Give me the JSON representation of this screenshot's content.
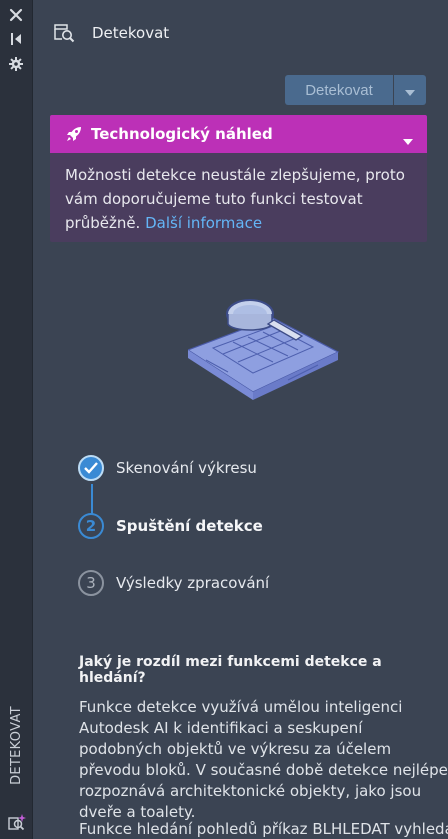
{
  "strip": {
    "close_icon": "close-icon",
    "collapse_icon": "collapse-panel-icon",
    "settings_icon": "gear-icon",
    "vertical_label": "DETEKOVAT",
    "bottom_icon": "detect-magnifier-sparkle-icon"
  },
  "header": {
    "title": "Detekovat",
    "icon": "detect-magnifier-icon"
  },
  "toolbar": {
    "detect_label": "Detekovat",
    "dropdown_icon": "caret-down-icon"
  },
  "preview": {
    "title": "Technologický náhled",
    "icon": "rocket-icon",
    "caret_icon": "caret-down-icon",
    "body_text": "Možnosti detekce neustále zlepšujeme, proto vám doporučujeme tuto funkci testovat průběžně.",
    "link_text": "Další informace",
    "bar_color": "#bc30b7",
    "body_color": "#4a3d5e",
    "link_color": "#64b5f6"
  },
  "illustration": {
    "icon": "blueprint-magnifier-illustration"
  },
  "steps": [
    {
      "number": "",
      "label": "Skenování výkresu",
      "state": "done"
    },
    {
      "number": "2",
      "label": "Spuštění detekce",
      "state": "active"
    },
    {
      "number": "3",
      "label": "Výsledky zpracování",
      "state": "pending"
    }
  ],
  "faq": {
    "question": "Jaký je rozdíl mezi funkcemi detekce a hledání?",
    "answer": "Funkce detekce využívá umělou inteligenci Autodesk AI k identifikaci a seskupení podobných objektů ve výkresu za účelem převodu bloků. V současné době detekce nejlépe rozpoznává architektonické objekty, jako jsou dveře a toalety.",
    "answer_cut": "Funkce hledání pohledů příkaz BLHLEDAT vyhledá"
  },
  "colors": {
    "background": "#3b4453",
    "accent": "#3a8ad4"
  }
}
